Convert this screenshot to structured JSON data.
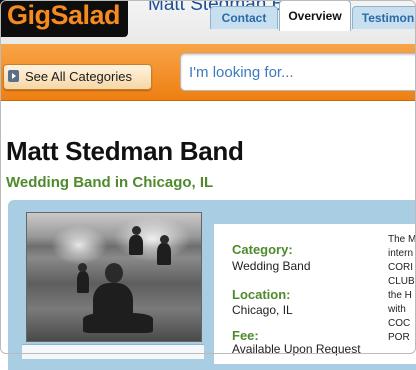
{
  "header": {
    "logo_text": "GigSalad",
    "title": "Matt Stedman Band"
  },
  "toolbar": {
    "categories_label": "See All Categories",
    "search_placeholder": "I'm looking for..."
  },
  "profile": {
    "name": "Matt Stedman Band",
    "subtitle": "Wedding Band in Chicago, IL"
  },
  "tabs": [
    {
      "label": "Contact",
      "active": false
    },
    {
      "label": "Overview",
      "active": true
    },
    {
      "label": "Testimon",
      "active": false
    }
  ],
  "details": {
    "category_label": "Category:",
    "category_value": "Wedding Band",
    "location_label": "Location:",
    "location_value": "Chicago, IL",
    "fee_label": "Fee:",
    "fee_value": "Available Upon Request"
  },
  "description_lines": [
    "The M",
    "intern",
    "CORI",
    "CLUB",
    "the H",
    "with",
    "COC",
    "POR"
  ],
  "colors": {
    "logo_orange": "#f58a1f",
    "bar_orange": "#ee7f12",
    "link_blue": "#1d4f96",
    "subtitle_green": "#4f8a2d",
    "panel_blue": "#a9cde2"
  }
}
